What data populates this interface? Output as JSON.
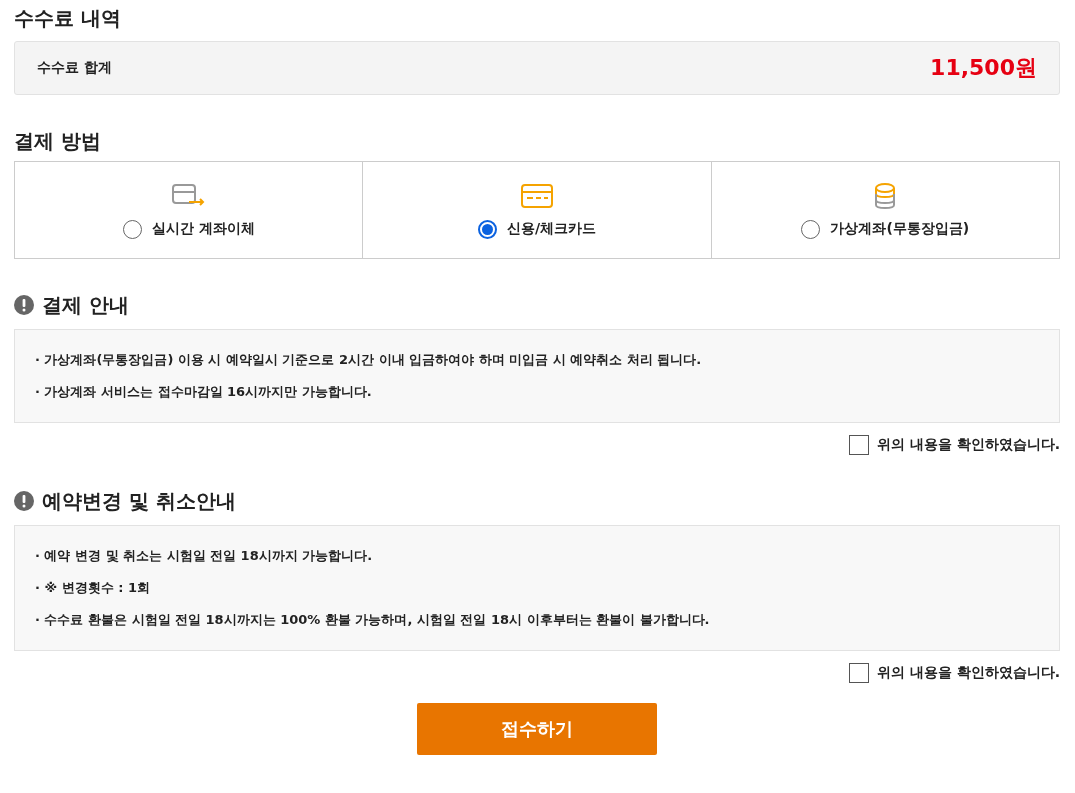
{
  "fee": {
    "title": "수수료 내역",
    "label": "수수료 합계",
    "amount": "11,500원"
  },
  "payment": {
    "title": "결제 방법",
    "methods": [
      {
        "kind": "transfer",
        "label": "실시간 계좌이체",
        "selected": false
      },
      {
        "kind": "card",
        "label": "신용/체크카드",
        "selected": true
      },
      {
        "kind": "coins",
        "label": "가상계좌(무통장입금)",
        "selected": false
      }
    ]
  },
  "notices": [
    {
      "title": "결제 안내",
      "lines": [
        "· 가상계좌(무통장입금) 이용 시 예약일시 기준으로 2시간 이내 입금하여야 하며 미입금 시 예약취소 처리 됩니다.",
        "· 가상계좌 서비스는 접수마감일 16시까지만 가능합니다."
      ],
      "confirm": {
        "label": "위의 내용을 확인하였습니다.",
        "checked": false
      }
    },
    {
      "title": "예약변경 및 취소안내",
      "lines": [
        "· 예약 변경 및 취소는 시험일 전일 18시까지 가능합니다.",
        "· ※ 변경횟수 : 1회",
        "· 수수료 환불은 시험일 전일 18시까지는 100% 환불 가능하며, 시험일 전일 18시 이후부터는 환불이 불가합니다."
      ],
      "confirm": {
        "label": "위의 내용을 확인하였습니다.",
        "checked": false
      }
    }
  ],
  "submit": "접수하기"
}
